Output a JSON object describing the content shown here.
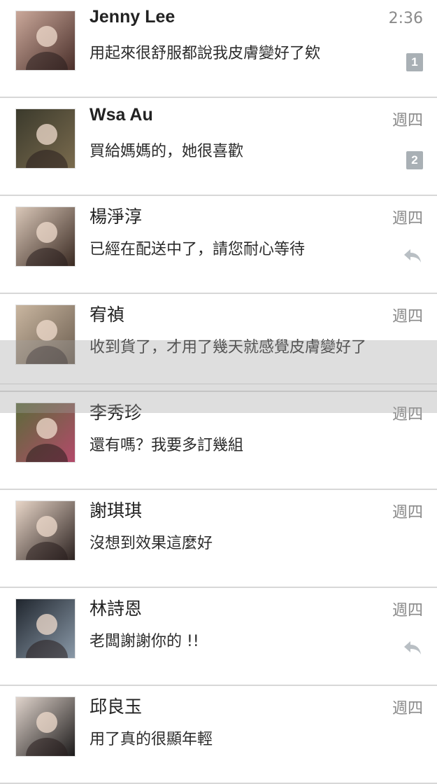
{
  "conversations": [
    {
      "name": "Jenny Lee",
      "message": "用起來很舒服都說我皮膚變好了欸",
      "time": "2:36",
      "badge": "1",
      "status": "badge",
      "bold": true,
      "avatar_colors": [
        "#caa89a",
        "#4a2f2a"
      ]
    },
    {
      "name": "Wsa Au",
      "message": "買給媽媽的，她很喜歡",
      "time": "週四",
      "badge": "2",
      "status": "badge",
      "bold": true,
      "avatar_colors": [
        "#3b3a2c",
        "#7a6b4e"
      ]
    },
    {
      "name": "楊淨淳",
      "message": "已經在配送中了，請您耐心等待",
      "time": "週四",
      "badge": "",
      "status": "replied",
      "bold": false,
      "avatar_colors": [
        "#d9c7b8",
        "#3a2a22"
      ]
    },
    {
      "name": "宥禎",
      "message": "收到貨了，才用了幾天就感覺皮膚變好了",
      "time": "週四",
      "badge": "",
      "status": "none",
      "bold": false,
      "avatar_colors": [
        "#c9b6a0",
        "#6b5d4f"
      ]
    },
    {
      "name": "李秀珍",
      "message": "還有嗎？我要多訂幾組",
      "time": "週四",
      "badge": "",
      "status": "none",
      "bold": false,
      "avatar_colors": [
        "#5b6b3a",
        "#b34a6a"
      ]
    },
    {
      "name": "謝琪琪",
      "message": "沒想到效果這麼好",
      "time": "週四",
      "badge": "",
      "status": "none",
      "bold": false,
      "avatar_colors": [
        "#e8d6c8",
        "#2c2220"
      ]
    },
    {
      "name": "林詩恩",
      "message": "老闆謝謝你的 !!",
      "time": "週四",
      "badge": "",
      "status": "replied",
      "bold": false,
      "avatar_colors": [
        "#20262e",
        "#8a99a8"
      ]
    },
    {
      "name": "邱良玉",
      "message": "用了真的很顯年輕",
      "time": "週四",
      "badge": "",
      "status": "none",
      "bold": false,
      "avatar_colors": [
        "#e0d4cc",
        "#1c1a1a"
      ]
    }
  ],
  "icons": {
    "reply": "reply-arrow-icon"
  }
}
